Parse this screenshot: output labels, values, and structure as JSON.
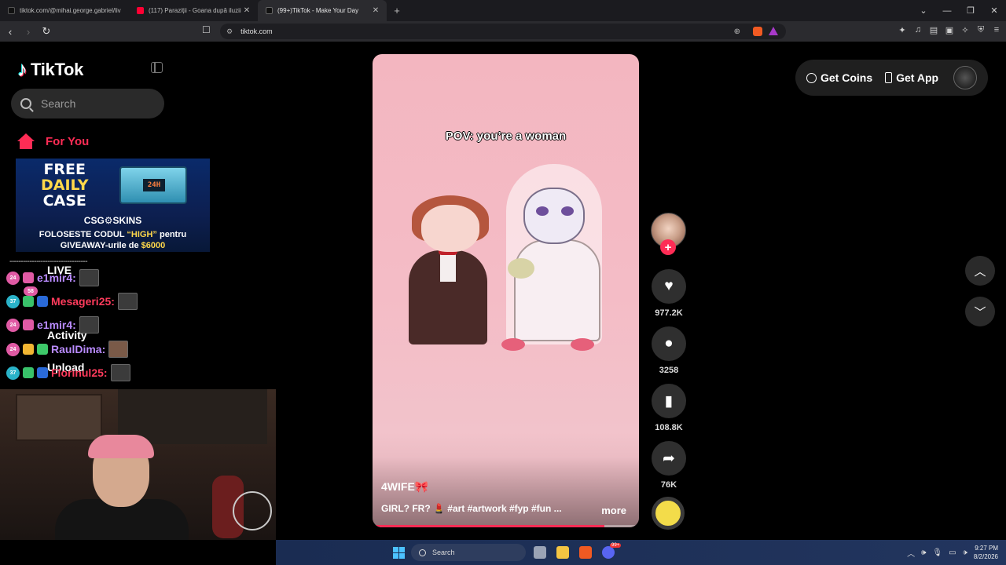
{
  "browser": {
    "tabs": [
      {
        "title": "tiktok.com/@mihai.george.gabriel/liv",
        "favicon": "tiktok-icon",
        "active": false
      },
      {
        "title": "(117) Paraziții - Goana după iluzii",
        "favicon": "youtube-icon",
        "active": false
      },
      {
        "title": "(99+)TikTok - Make Your Day",
        "favicon": "tiktok-icon",
        "active": true
      }
    ],
    "new_tab_glyph": "+",
    "url": "tiktok.com"
  },
  "tiktok": {
    "logo_text": "TikTok",
    "search_placeholder": "Search",
    "nav": {
      "for_you": "For You",
      "live": "LIVE",
      "activity": "Activity",
      "upload": "Upload"
    },
    "top_right": {
      "get_coins": "Get Coins",
      "get_app": "Get App"
    },
    "accent_color": "#fe2c55"
  },
  "ad": {
    "line1": "FREE",
    "line2": "DAILY",
    "line3": "CASE",
    "crate_label": "24H",
    "brand": "CSG⚙SKINS",
    "code_prefix": "FOLOSESTE CODUL ",
    "code": "“HIGH”",
    "code_suffix": " pentru",
    "giveaway_prefix": "GIVEAWAY-urile de ",
    "giveaway_amount": "$6000"
  },
  "chat": {
    "separator": "-----------------------------------",
    "messages": [
      {
        "badge": "24",
        "name": "e1mir4:",
        "color": "#b98bff"
      },
      {
        "badge": "37",
        "name": "Mesageri25:",
        "color": "#ff3b5c"
      },
      {
        "badge": "24",
        "name": "e1mir4:",
        "color": "#b98bff"
      },
      {
        "badge": "24",
        "name": "RaulDima:",
        "color": "#b98bff"
      },
      {
        "badge": "37",
        "name": "Florinul25:",
        "color": "#ff3b5c"
      }
    ],
    "live_count_badge": "58"
  },
  "video": {
    "overlay_caption": "POV: you’re a woman",
    "title": "4WIFE🎀",
    "description": "GIRL? FR? 💄 #art #artwork #fyp #fun ...",
    "more_label": "more",
    "progress": 0.87
  },
  "actions": {
    "follow_glyph": "+",
    "likes": "977.2K",
    "comments": "3258",
    "saves": "108.8K",
    "shares": "76K"
  },
  "taskbar": {
    "search_placeholder": "Search",
    "notification_badge": "99+",
    "time": "9:27 PM",
    "date": "8/2/2026"
  }
}
